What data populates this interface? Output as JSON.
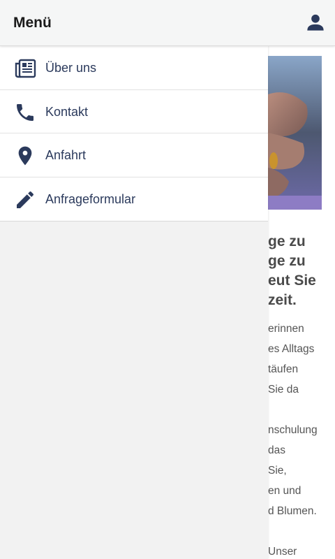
{
  "header": {
    "title": "Menü",
    "user_icon": "user-icon"
  },
  "drawer": {
    "items": [
      {
        "label": "Über uns",
        "icon": "newspaper-icon"
      },
      {
        "label": "Kontakt",
        "icon": "phone-icon"
      },
      {
        "label": "Anfahrt",
        "icon": "map-pin-icon"
      },
      {
        "label": "Anfrageformular",
        "icon": "pencil-icon"
      }
    ]
  },
  "background_page": {
    "heading_lines": [
      "ge zu",
      "ge zu",
      "eut Sie",
      "zeit."
    ],
    "paragraph_lines": [
      "erinnen",
      "es Alltags",
      "täufen",
      " Sie da",
      "",
      "nschulung",
      " das",
      " Sie,",
      "en und",
      "d Blumen.",
      "",
      "Unser"
    ]
  },
  "colors": {
    "accent": "#2b3a5c",
    "header_bg": "#f5f6f6",
    "drawer_bg": "#f2f2f2"
  }
}
